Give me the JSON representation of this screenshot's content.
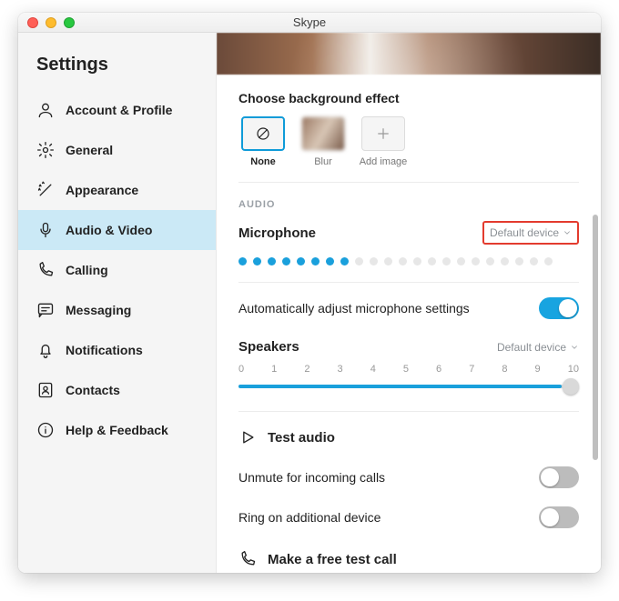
{
  "window": {
    "title": "Skype"
  },
  "sidebar": {
    "heading": "Settings",
    "items": [
      {
        "label": "Account & Profile"
      },
      {
        "label": "General"
      },
      {
        "label": "Appearance"
      },
      {
        "label": "Audio & Video"
      },
      {
        "label": "Calling"
      },
      {
        "label": "Messaging"
      },
      {
        "label": "Notifications"
      },
      {
        "label": "Contacts"
      },
      {
        "label": "Help & Feedback"
      }
    ]
  },
  "main": {
    "bg_effect_title": "Choose background effect",
    "effects": {
      "none": "None",
      "blur": "Blur",
      "add": "Add image"
    },
    "audio_group": "AUDIO",
    "microphone": {
      "label": "Microphone",
      "device": "Default device",
      "active_level": 8,
      "total_level": 22
    },
    "auto_adjust": {
      "label": "Automatically adjust microphone settings",
      "value": true
    },
    "speakers": {
      "label": "Speakers",
      "device": "Default device",
      "ticks": [
        "0",
        "1",
        "2",
        "3",
        "4",
        "5",
        "6",
        "7",
        "8",
        "9",
        "10"
      ],
      "value": 10
    },
    "test_audio": "Test audio",
    "unmute": {
      "label": "Unmute for incoming calls",
      "value": false
    },
    "ring_additional": {
      "label": "Ring on additional device",
      "value": false
    },
    "test_call": "Make a free test call"
  }
}
